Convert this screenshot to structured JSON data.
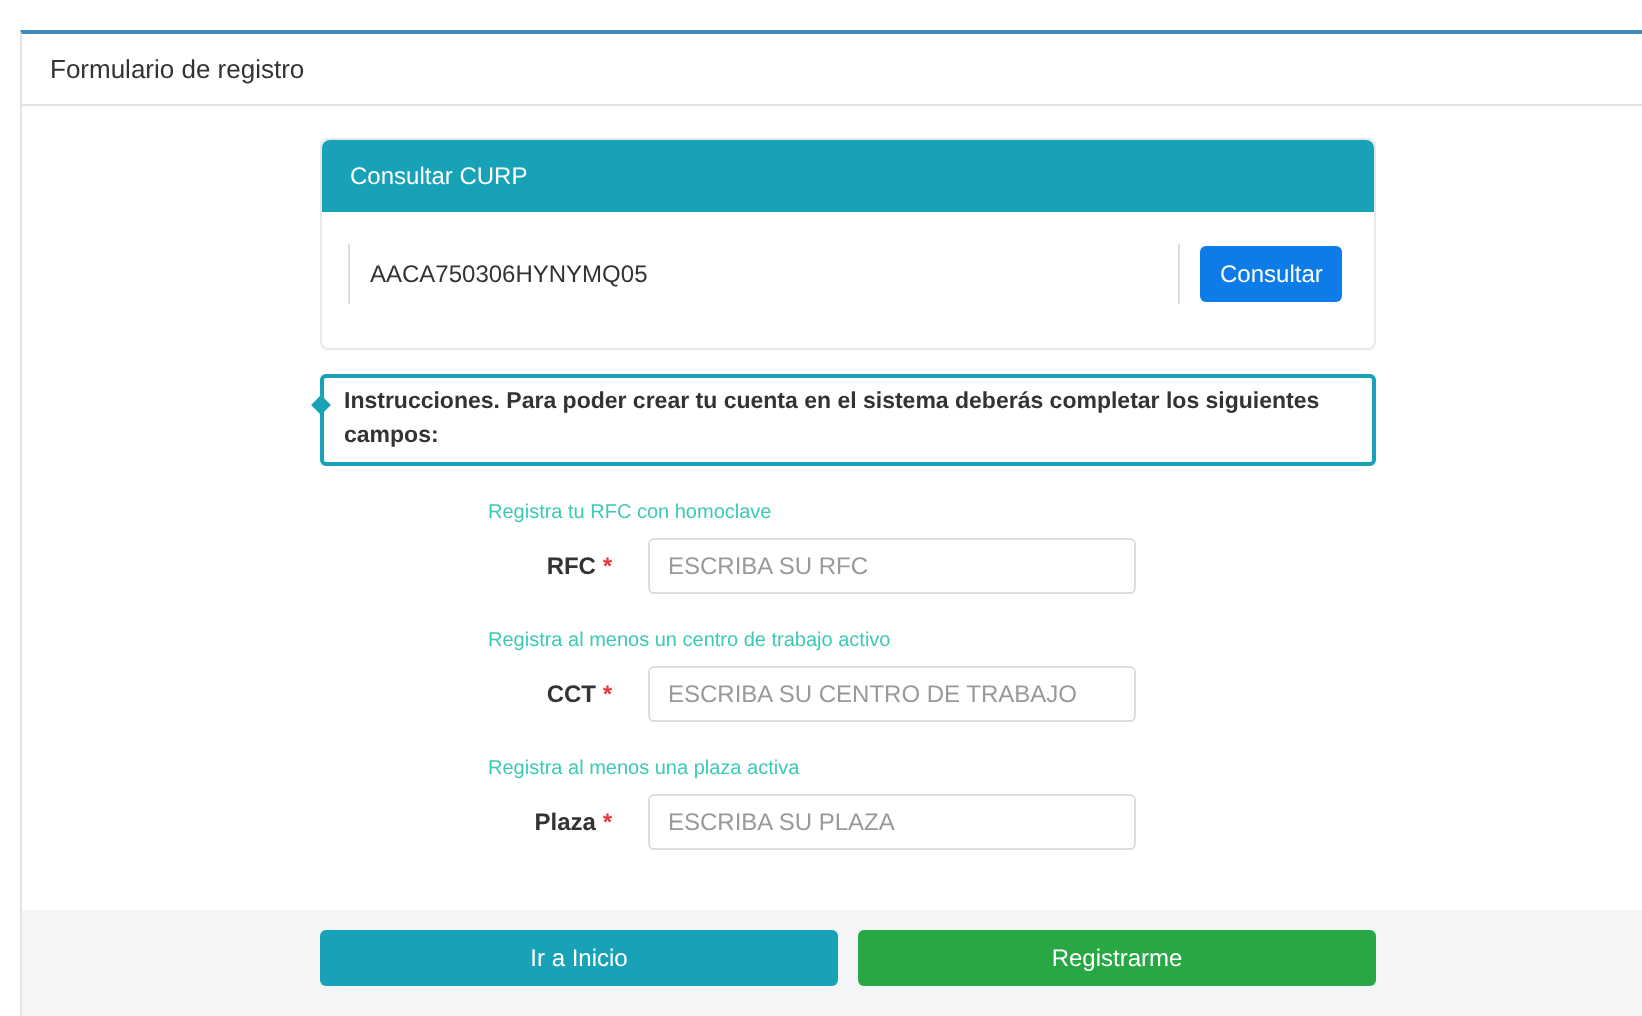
{
  "panel": {
    "title": "Formulario de registro"
  },
  "curp": {
    "title": "Consultar CURP",
    "value": "AACA750306HYNYMQ05",
    "button": "Consultar"
  },
  "instructions": "Instrucciones. Para poder crear tu cuenta en el sistema deberás completar los siguientes campos:",
  "fields": [
    {
      "hint": "Registra tu RFC con homoclave",
      "label": "RFC",
      "required": "*",
      "placeholder": "ESCRIBA SU RFC"
    },
    {
      "hint": "Registra al menos un centro de trabajo activo",
      "label": "CCT",
      "required": "*",
      "placeholder": "ESCRIBA SU CENTRO DE TRABAJO"
    },
    {
      "hint": "Registra al menos una plaza activa",
      "label": "Plaza",
      "required": "*",
      "placeholder": "ESCRIBA SU PLAZA"
    }
  ],
  "footer_buttons": [
    {
      "label": "Ir a Inicio",
      "kind": "info"
    },
    {
      "label": "Registrarme",
      "kind": "success"
    }
  ]
}
